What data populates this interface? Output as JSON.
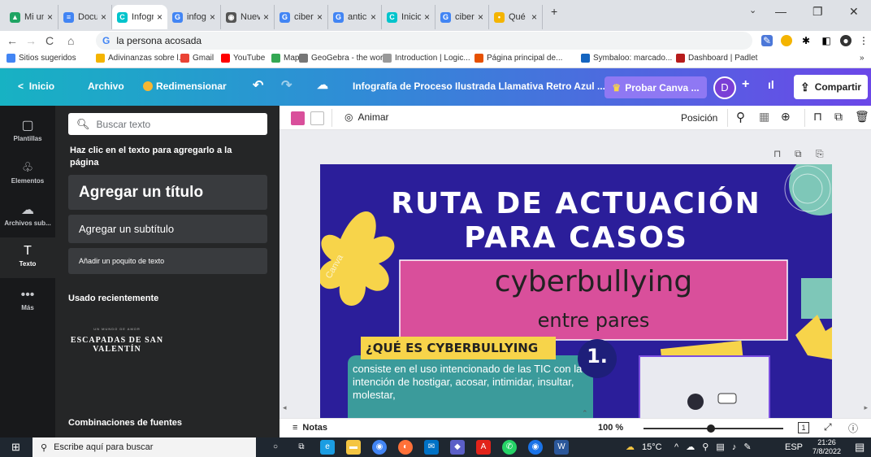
{
  "browser": {
    "tabs": [
      {
        "title": "Mi unida",
        "color": "#1fa463",
        "glyph": "▲"
      },
      {
        "title": "Docume",
        "color": "#4285f4",
        "glyph": "≡"
      },
      {
        "title": "Infografí",
        "color": "#00c4cc",
        "glyph": "C",
        "active": true
      },
      {
        "title": "infografí",
        "color": "#4285f4",
        "glyph": "G"
      },
      {
        "title": "Nueva p",
        "color": "#555",
        "glyph": "◉"
      },
      {
        "title": "ciberaco",
        "color": "#4285f4",
        "glyph": "G"
      },
      {
        "title": "anticipa",
        "color": "#4285f4",
        "glyph": "G"
      },
      {
        "title": "Inicio - (",
        "color": "#00c4cc",
        "glyph": "C"
      },
      {
        "title": "ciberaco",
        "color": "#4285f4",
        "glyph": "G"
      },
      {
        "title": "Qué es e",
        "color": "#f4b400",
        "glyph": "•"
      }
    ],
    "new_tab": "+",
    "address": "la persona acosada",
    "address_prefix": "G",
    "bookmarks": [
      {
        "label": "Sitios sugeridos",
        "color": "#4285f4"
      },
      {
        "label": "Adivinanzas sobre l...",
        "color": "#f4b400"
      },
      {
        "label": "Gmail",
        "color": "#ea4335"
      },
      {
        "label": "YouTube",
        "color": "#ff0000"
      },
      {
        "label": "Maps",
        "color": "#34a853"
      },
      {
        "label": "GeoGebra - the wor...",
        "color": "#777"
      },
      {
        "label": "Introduction | Logic...",
        "color": "#999"
      },
      {
        "label": "Página principal de...",
        "color": "#e65100"
      },
      {
        "label": "Symbaloo: marcado...",
        "color": "#1565c0"
      },
      {
        "label": "Dashboard | Padlet",
        "color": "#b71c1c"
      }
    ],
    "bookmarks_more": "»"
  },
  "canva": {
    "header": {
      "home": "Inicio",
      "file": "Archivo",
      "resize": "Redimensionar",
      "doc_title": "Infografía de Proceso Ilustrada Llamativa Retro Azul ...",
      "try_pro": "Probar Canva ...",
      "avatar_letter": "D",
      "share": "Compartir"
    },
    "rail": [
      {
        "label": "Plantillas",
        "icon": "▢"
      },
      {
        "label": "Elementos",
        "icon": "♧"
      },
      {
        "label": "Archivos sub...",
        "icon": "☁"
      },
      {
        "label": "Texto",
        "icon": "T",
        "selected": true
      },
      {
        "label": "Más",
        "icon": "•••"
      }
    ],
    "panel": {
      "search_placeholder": "Buscar texto",
      "hint": "Haz clic en el texto para agregarlo a la página",
      "add_title": "Agregar un título",
      "add_subtitle": "Agregar un subtítulo",
      "add_body": "Añadir un poquito de texto",
      "recent_heading": "Usado recientemente",
      "recent_thumb_small": "UN MUNDO DE AMOR",
      "recent_thumb_big": "ESCAPADAS DE SAN VALENTÍN",
      "combos_heading": "Combinaciones de fuentes"
    },
    "toolbar": {
      "animate": "Animar",
      "position": "Posición"
    },
    "design": {
      "title_line1": "RUTA DE ACTUACIÓN",
      "title_line2": "PARA CASOS",
      "banner_main": "cyberbullying",
      "banner_sub": "entre pares",
      "question": "¿QUÉ ES CYBERBULLYING",
      "step_number": "1.",
      "body": "consiste en el uso intencionado de las TIC con la intención de hostigar, acosar, intimidar, insultar, molestar,",
      "watermark": "Canva"
    },
    "bottombar": {
      "notes": "Notas",
      "zoom": "100 %",
      "zoom_level": 0.48,
      "page": "1"
    }
  },
  "taskbar": {
    "search_placeholder": "Escribe aquí para buscar",
    "weather": "15°C",
    "lang": "ESP",
    "time": "21:26",
    "date": "7/8/2022"
  },
  "colors": {
    "design_bg": "#2b1e9a",
    "banner": "#d94f9b",
    "yellow": "#f7d44a",
    "teal": "#3b9b9b",
    "question_bg": "#f7d44a"
  }
}
